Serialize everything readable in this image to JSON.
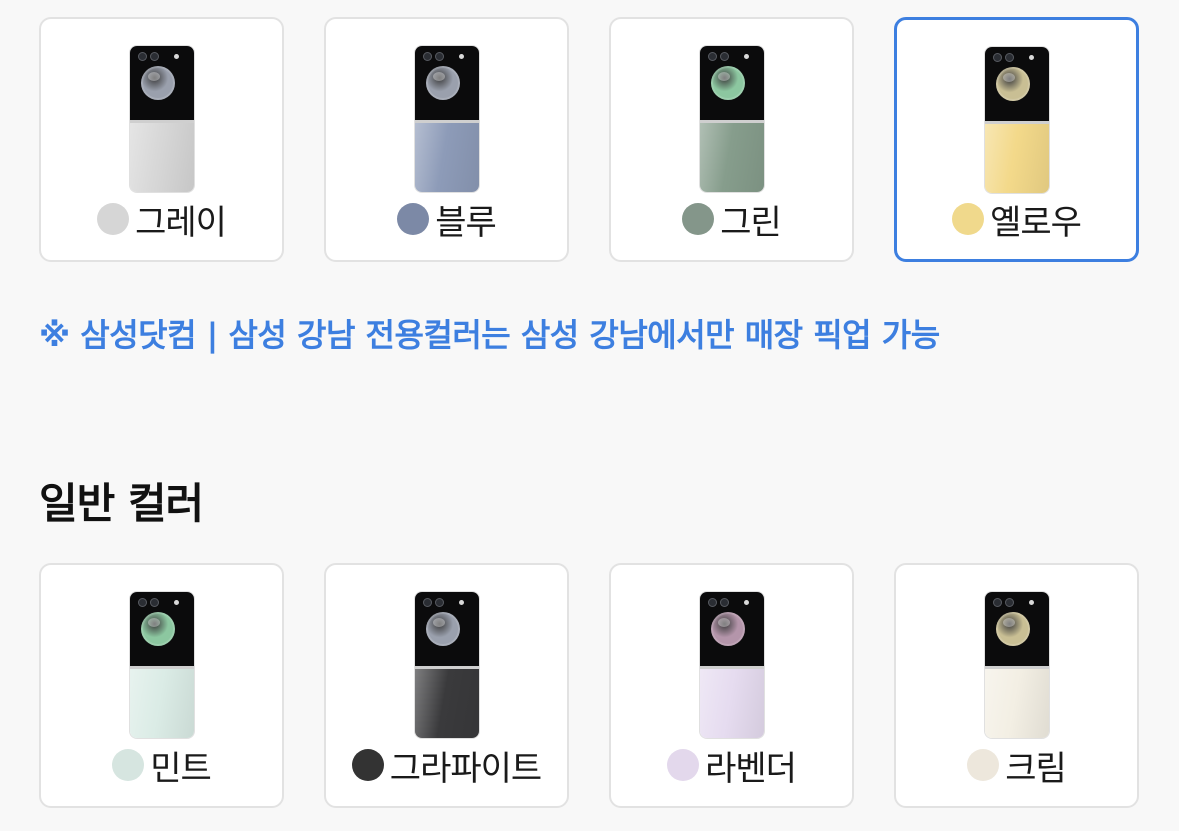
{
  "exclusive_colors": [
    {
      "name": "그레이",
      "swatch": "#d6d6d6",
      "back": "#d7d7d7",
      "lens": "#9aa0ad",
      "selected": false
    },
    {
      "name": "블루",
      "swatch": "#7c89a6",
      "back": "#8d9bb8",
      "lens": "#9aa0ad",
      "selected": false
    },
    {
      "name": "그린",
      "swatch": "#84968a",
      "back": "#869d8c",
      "lens": "#8cc7a0",
      "selected": false
    },
    {
      "name": "옐로우",
      "swatch": "#f0d98c",
      "back": "#f3d98a",
      "lens": "#c9bf94",
      "selected": true
    }
  ],
  "notice": "※ 삼성닷컴 | 삼성 강남 전용컬러는 삼성 강남에서만 매장 픽업 가능",
  "section_title": "일반 컬러",
  "standard_colors": [
    {
      "name": "민트",
      "swatch": "#d6e5e0",
      "back": "#dbece6",
      "lens": "#8cc7a0",
      "selected": false
    },
    {
      "name": "그라파이트",
      "swatch": "#333333",
      "back": "#3a3a3c",
      "lens": "#9aa0ad",
      "selected": false
    },
    {
      "name": "라벤더",
      "swatch": "#e3d8ec",
      "back": "#e6dcf0",
      "lens": "#b495aa",
      "selected": false
    },
    {
      "name": "크림",
      "swatch": "#ede7dc",
      "back": "#f3efe4",
      "lens": "#c9bf94",
      "selected": false
    }
  ],
  "accent_color": "#3d7fe0"
}
